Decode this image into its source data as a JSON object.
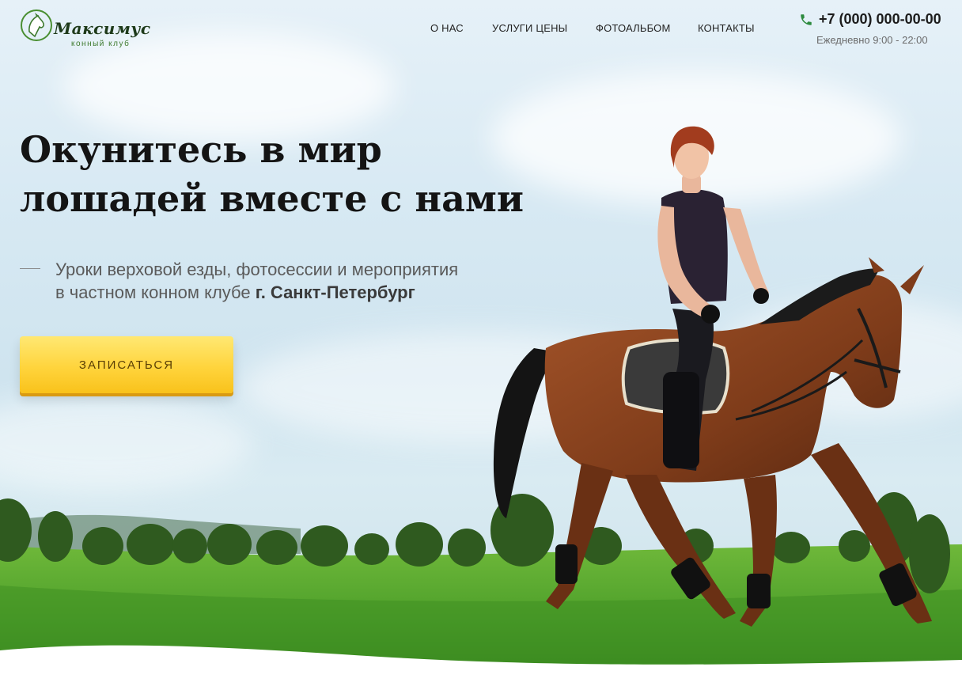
{
  "header": {
    "logo": {
      "name": "Максимус",
      "subtitle": "конный клуб"
    },
    "nav": [
      {
        "label": "О НАС"
      },
      {
        "label": "УСЛУГИ ЦЕНЫ"
      },
      {
        "label": "ФОТОАЛЬБОМ"
      },
      {
        "label": "КОНТАКТЫ"
      }
    ],
    "phone": "+7 (000) 000-00-00",
    "hours": "Ежедневно 9:00 - 22:00"
  },
  "hero": {
    "title_line1": "Окунитесь в мир",
    "title_line2": "лошадей вместе с нами",
    "subtitle_line1": "Уроки верховой езды, фотосессии и мероприятия",
    "subtitle_line2_prefix": "в частном конном клубе ",
    "subtitle_city": "г. Санкт-Петербург",
    "cta_label": "ЗАПИСАТЬСЯ"
  },
  "colors": {
    "accent": "#ffd43c",
    "brand_green": "#3e7a2e",
    "phone_icon": "#2c8a3e"
  },
  "icons": {
    "phone": "phone-icon",
    "logo": "horse-head-logo-icon"
  }
}
